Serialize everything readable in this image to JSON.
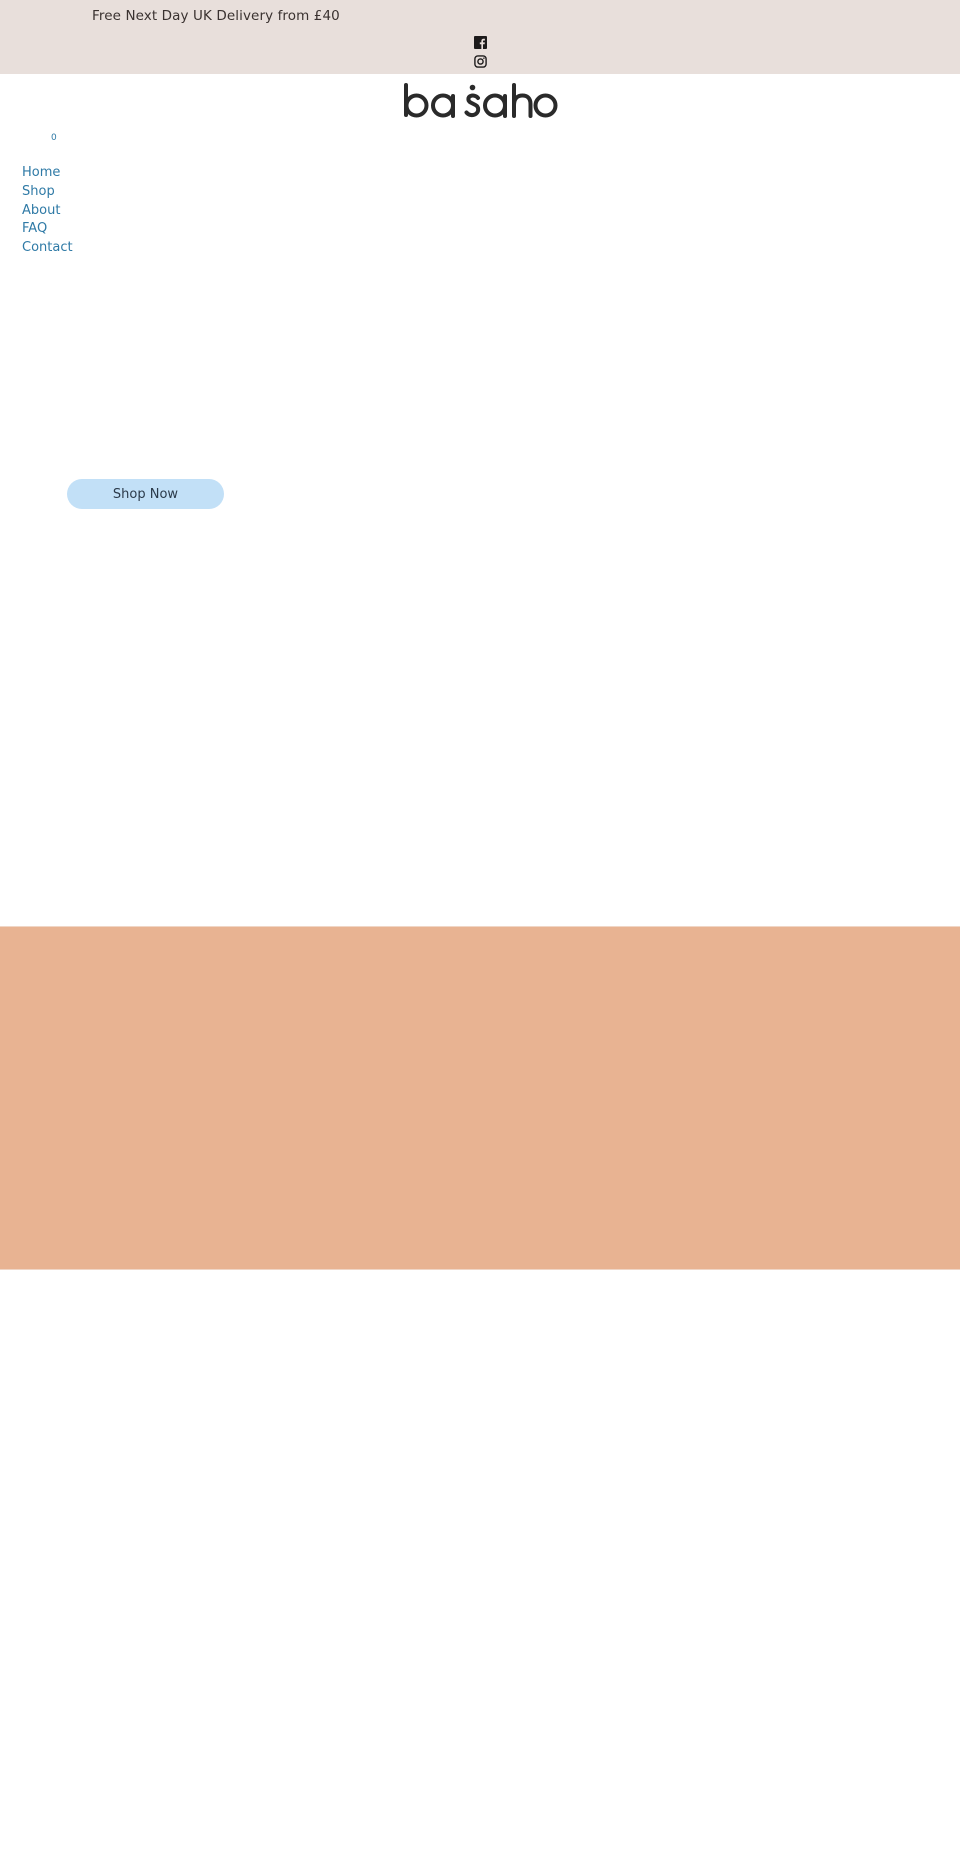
{
  "announcement": {
    "text": "Free Next Day UK Delivery from £40",
    "social_links": [
      {
        "name": "facebook",
        "icon": "facebook-icon"
      },
      {
        "name": "instagram",
        "icon": "instagram-icon"
      }
    ]
  },
  "header": {
    "logo_text": "basaho",
    "cart_count": "0"
  },
  "nav": {
    "items": [
      {
        "label": "Home"
      },
      {
        "label": "Shop"
      },
      {
        "label": "About"
      },
      {
        "label": "FAQ"
      },
      {
        "label": "Contact"
      }
    ]
  },
  "hero": {
    "cta_label": "Shop Now"
  },
  "colors": {
    "announcement_bg": "#e8dfdb",
    "nav_link": "#2f7aa6",
    "cta_bg": "#c2e0f7",
    "promo_band_bg": "#e8b392",
    "logo": "#2a2a2a"
  }
}
